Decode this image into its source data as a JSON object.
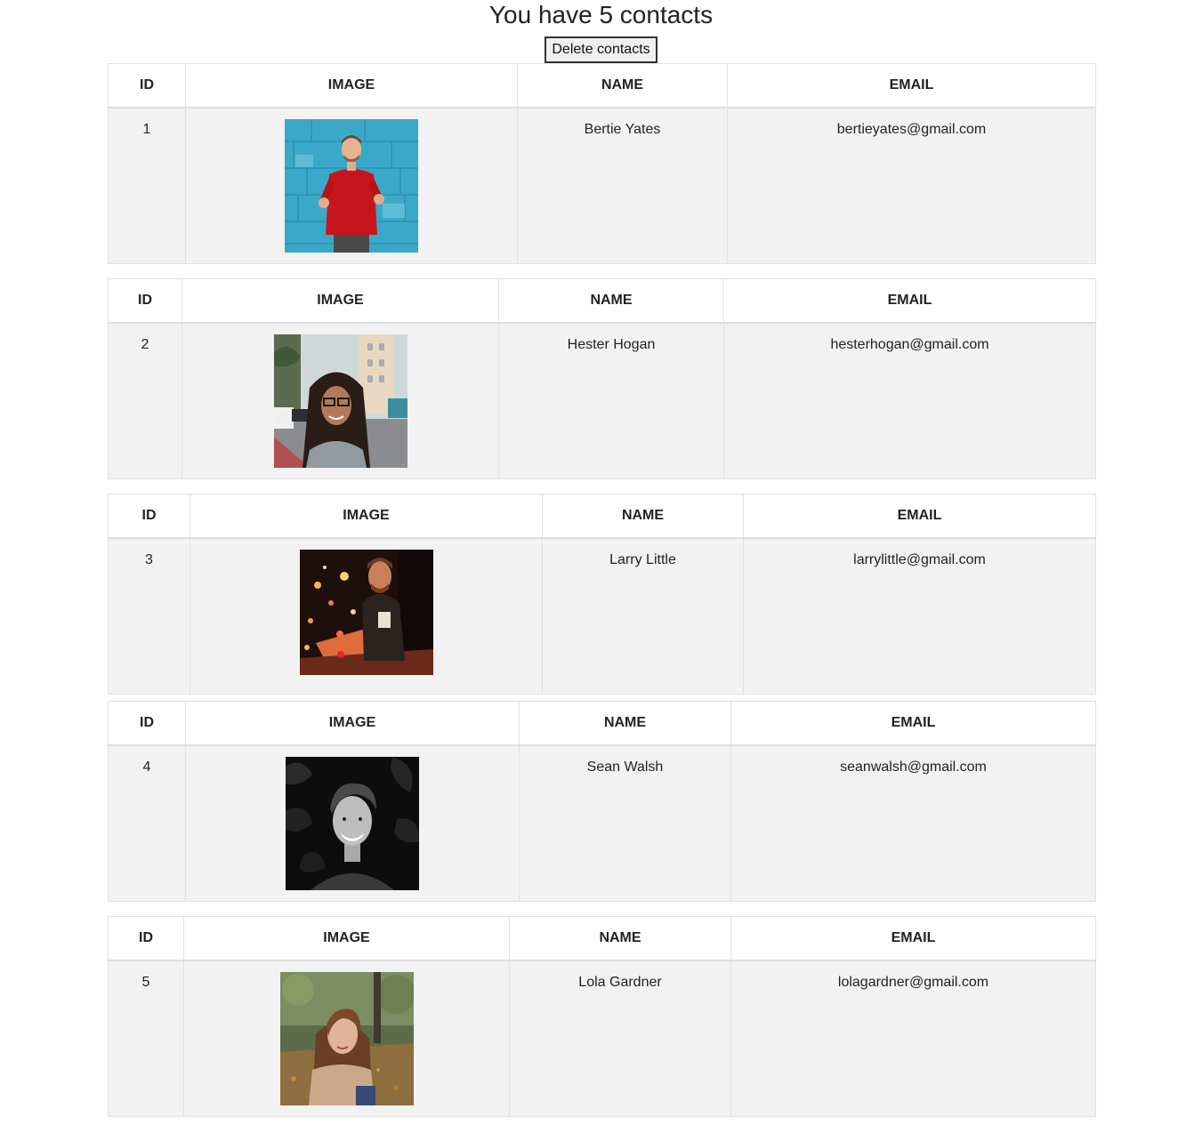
{
  "page": {
    "heading": "You have 5 contacts",
    "delete_button_label": "Delete contacts"
  },
  "columns": {
    "id": "ID",
    "image": "IMAGE",
    "name": "NAME",
    "email": "EMAIL"
  },
  "contacts": [
    {
      "id": "1",
      "name": "Bertie Yates",
      "email": "bertieyates@gmail.com",
      "photo": "man-red-sweater-blue-wall-photo"
    },
    {
      "id": "2",
      "name": "Hester Hogan",
      "email": "hesterhogan@gmail.com",
      "photo": "woman-glasses-city-street-photo"
    },
    {
      "id": "3",
      "name": "Larry Little",
      "email": "larrylittle@gmail.com",
      "photo": "man-laptop-night-lights-photo"
    },
    {
      "id": "4",
      "name": "Sean Walsh",
      "email": "seanwalsh@gmail.com",
      "photo": "man-smiling-black-white-photo"
    },
    {
      "id": "5",
      "name": "Lola Gardner",
      "email": "lolagardner@gmail.com",
      "photo": "woman-park-autumn-photo"
    }
  ]
}
